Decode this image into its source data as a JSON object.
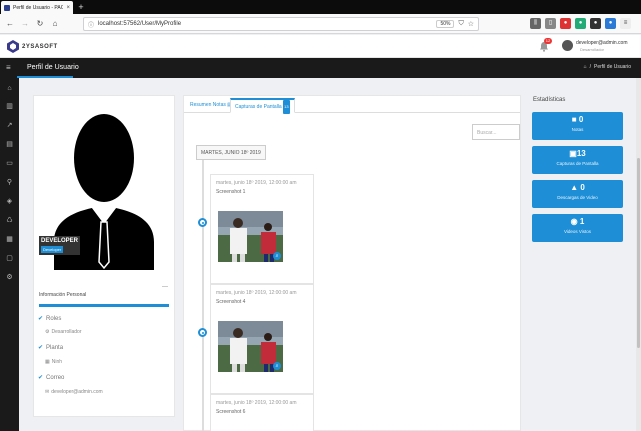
{
  "browser": {
    "tab_title": "Perfil de Usuario - PAC3",
    "tab_close": "×",
    "new_tab": "+",
    "url": "localhost:57562/User/MyProfile",
    "zoom": "50%"
  },
  "app": {
    "logo_text": "2YSASOFT",
    "notif_count": "12",
    "user_email": "developer@admin.com",
    "user_role": "Desarrollador"
  },
  "titlebar": {
    "title": "Perfil de Usuario",
    "breadcrumb_sep": "/",
    "breadcrumb": "Perfil de Usuario"
  },
  "profile": {
    "role_title": "DEVELOPER",
    "role_chip": "Developer",
    "info_title": "Información Personal",
    "items": [
      {
        "label": "Roles",
        "value": "Desarrollador"
      },
      {
        "label": "Planta",
        "value": "Ninh"
      },
      {
        "label": "Correo",
        "value": "developer@admin.com"
      }
    ]
  },
  "tabs": [
    {
      "label": "Resumen Notas",
      "badge": ""
    },
    {
      "label": "Capturas de Pantalla",
      "badge": "13"
    }
  ],
  "search": {
    "placeholder": "Buscar..."
  },
  "timeline": {
    "date": "MARTES, JUNIO 18º 2019",
    "entries": [
      {
        "date": "martes, junio 18º 2019, 12:00:00 am",
        "name": "Screenshot 1"
      },
      {
        "date": "martes, junio 18º 2019, 12:00:00 am",
        "name": "Screenshot 4"
      },
      {
        "date": "martes, junio 18º 2019, 12:00:00 am",
        "name": "Screenshot 6"
      }
    ]
  },
  "stats": {
    "title": "Estadísticas",
    "items": [
      {
        "icon": "file-icon",
        "value": "0",
        "label": "Notas"
      },
      {
        "icon": "image-icon",
        "value": "13",
        "label": "Capturas de Pantalla"
      },
      {
        "icon": "download-icon",
        "value": "0",
        "label": "Descargas de Video"
      },
      {
        "icon": "eye-icon",
        "value": "1",
        "label": "Videos Vistos"
      }
    ]
  },
  "colors": {
    "accent": "#1e8fd6",
    "dark": "#1a1a1a"
  }
}
